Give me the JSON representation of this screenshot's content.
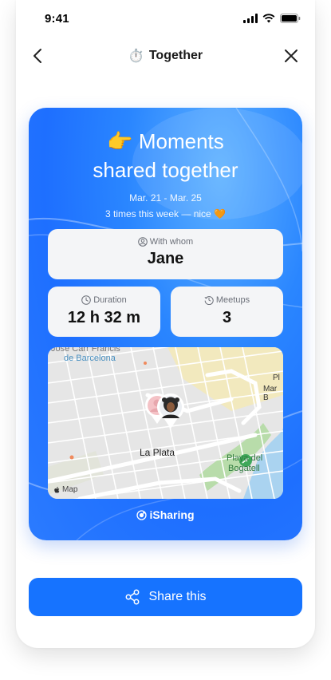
{
  "status_bar": {
    "time": "9:41"
  },
  "nav": {
    "title_icon": "⏱️",
    "title": "Together"
  },
  "card": {
    "title_emoji": "👉",
    "title_line1": "Moments",
    "title_line2": "shared together",
    "date_range": "Mar. 21 - Mar. 25",
    "note": "3 times this week — nice 🧡",
    "whom_label": "With whom",
    "whom_value": "Jane",
    "duration_label": "Duration",
    "duration_value": "12 h 32 m",
    "meetups_label": "Meetups",
    "meetups_value": "3",
    "brand": "iSharing"
  },
  "map": {
    "labels": {
      "street_top": "Jose Carr Francis",
      "barcelona": "de Barcelona",
      "la_plata": "La Plata",
      "playa_1": "Playa del",
      "playa_2": "Bogatell",
      "right_1": "Pl",
      "right_2": "Mar B"
    },
    "attribution": "Map",
    "colors": {
      "park": "#b8dcaa",
      "water": "#aad3f0",
      "road": "#ffffff",
      "highlight": "#f5eab0"
    }
  },
  "share_button": {
    "label": "Share this"
  },
  "colors": {
    "accent": "#1673ff",
    "card_blue": "#2a86ff"
  }
}
